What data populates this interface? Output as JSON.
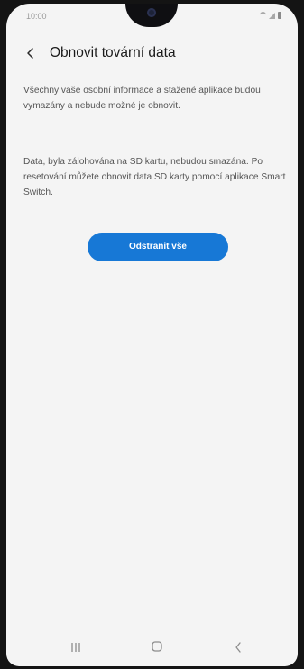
{
  "status_bar": {
    "time": "10:00",
    "icons": [
      "wifi-icon",
      "signal-icon",
      "battery-icon"
    ]
  },
  "header": {
    "back_icon": "chevron-left-icon",
    "title": "Obnovit tovární data"
  },
  "content": {
    "paragraph_1": "Všechny vaše osobní informace a stažené aplikace budou vymazány a nebude možné je obnovit.",
    "paragraph_2": "Data, byla zálohována na SD kartu, nebudou smazána. Po resetování můžete obnovit data SD karty pomocí aplikace Smart Switch."
  },
  "actions": {
    "remove_all_label": "Odstranit vše",
    "accent_color": "#1778d6"
  },
  "nav_bar": {
    "icons": [
      "recent-apps-icon",
      "home-icon",
      "back-icon"
    ]
  }
}
